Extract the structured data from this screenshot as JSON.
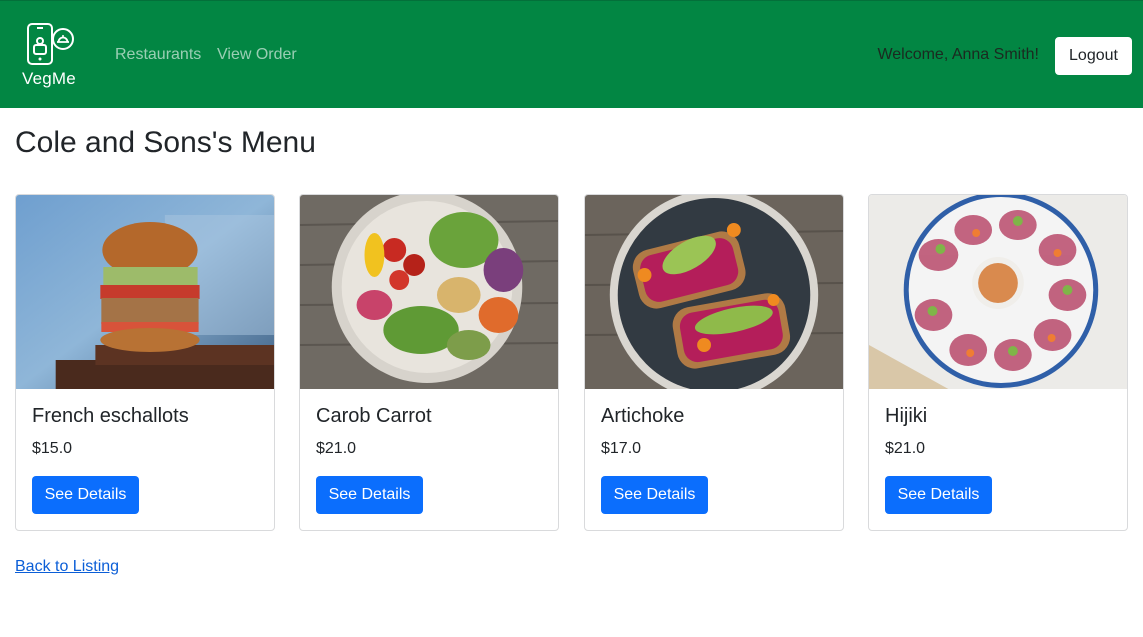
{
  "navbar": {
    "brand": "VegMe",
    "links": [
      "Restaurants",
      "View Order"
    ],
    "welcome": "Welcome, Anna Smith!",
    "logout_label": "Logout"
  },
  "page": {
    "title": "Cole and Sons's Menu",
    "back_link": "Back to Listing"
  },
  "menu_items": [
    {
      "name": "French eschallots",
      "price": "$15.0",
      "button": "See Details",
      "image": "burger-photo"
    },
    {
      "name": "Carob Carrot",
      "price": "$21.0",
      "button": "See Details",
      "image": "salad-bowl-photo"
    },
    {
      "name": "Artichoke",
      "price": "$17.0",
      "button": "See Details",
      "image": "avocado-toast-photo"
    },
    {
      "name": "Hijiki",
      "price": "$21.0",
      "button": "See Details",
      "image": "spring-rolls-photo"
    }
  ],
  "colors": {
    "navbar": "#028643",
    "primary_button": "#0b6efd",
    "link": "#0b5ed7"
  }
}
